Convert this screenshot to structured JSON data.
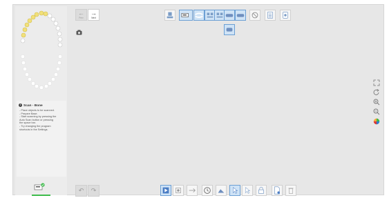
{
  "header": {
    "prev_label": "Prev",
    "next_label": "Next"
  },
  "info_panel": {
    "title": "Scan - Bone",
    "info_icon": "i",
    "lines": [
      "- Place objects to be scanned.",
      "- Prepare Base.",
      "- Start scanning by pressing the",
      "  Auto Scan button or pressing",
      "  the space bar.",
      "- Try changing the program",
      "  shortcuts in the Settings."
    ]
  },
  "colors": {
    "status_bar": "#3dbb4a",
    "check_badge": "#3dbb4a",
    "selected_tool": "#cfe3f6",
    "tooth_selected": "#f1e07a",
    "tooth_default": "#ffffff"
  },
  "icons": {
    "top_toolbar": [
      "upper-jaw-icon",
      "scan-mode-icon",
      "bite-icon",
      "maxilla-icon",
      "mandible-icon",
      "full-arch-icon",
      "occlusion-icon",
      "no-marker-icon",
      "tooth-list-icon",
      "scanner-settings-icon",
      "sub-tool-icon"
    ],
    "bottom_toolbar": [
      "auto-scan-icon",
      "record-icon",
      "undo-scan-icon",
      "history-icon",
      "mountain-icon",
      "select-icon",
      "lasso-icon",
      "lock-icon",
      "document-icon",
      "trash-icon"
    ],
    "right_toolbar": [
      "fit-screen-icon",
      "rotate-icon",
      "zoom-in-icon",
      "zoom-out-icon",
      "color-icon"
    ]
  }
}
